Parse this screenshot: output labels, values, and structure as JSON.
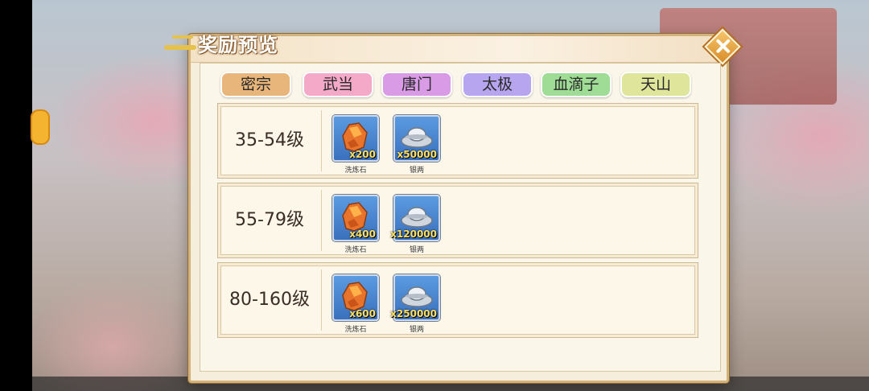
{
  "panel": {
    "title": "奖励预览"
  },
  "tabs": [
    {
      "label": "密宗",
      "color": "#e8b67a"
    },
    {
      "label": "武当",
      "color": "#f3a9c7"
    },
    {
      "label": "唐门",
      "color": "#d99ae6"
    },
    {
      "label": "太极",
      "color": "#b7a5ef"
    },
    {
      "label": "血滴子",
      "color": "#9fdc96"
    },
    {
      "label": "天山",
      "color": "#dfe59b"
    }
  ],
  "rows": [
    {
      "level": "35-54级",
      "items": [
        {
          "icon": "ore-icon",
          "qty": "x200",
          "name": "洗炼石"
        },
        {
          "icon": "silver-ingot-icon",
          "qty": "x50000",
          "name": "银两"
        }
      ]
    },
    {
      "level": "55-79级",
      "items": [
        {
          "icon": "ore-icon",
          "qty": "x400",
          "name": "洗炼石"
        },
        {
          "icon": "silver-ingot-icon",
          "qty": "x120000",
          "name": "银两"
        }
      ]
    },
    {
      "level": "80-160级",
      "items": [
        {
          "icon": "ore-icon",
          "qty": "x600",
          "name": "洗炼石"
        },
        {
          "icon": "silver-ingot-icon",
          "qty": "x250000",
          "name": "银两"
        }
      ]
    }
  ]
}
